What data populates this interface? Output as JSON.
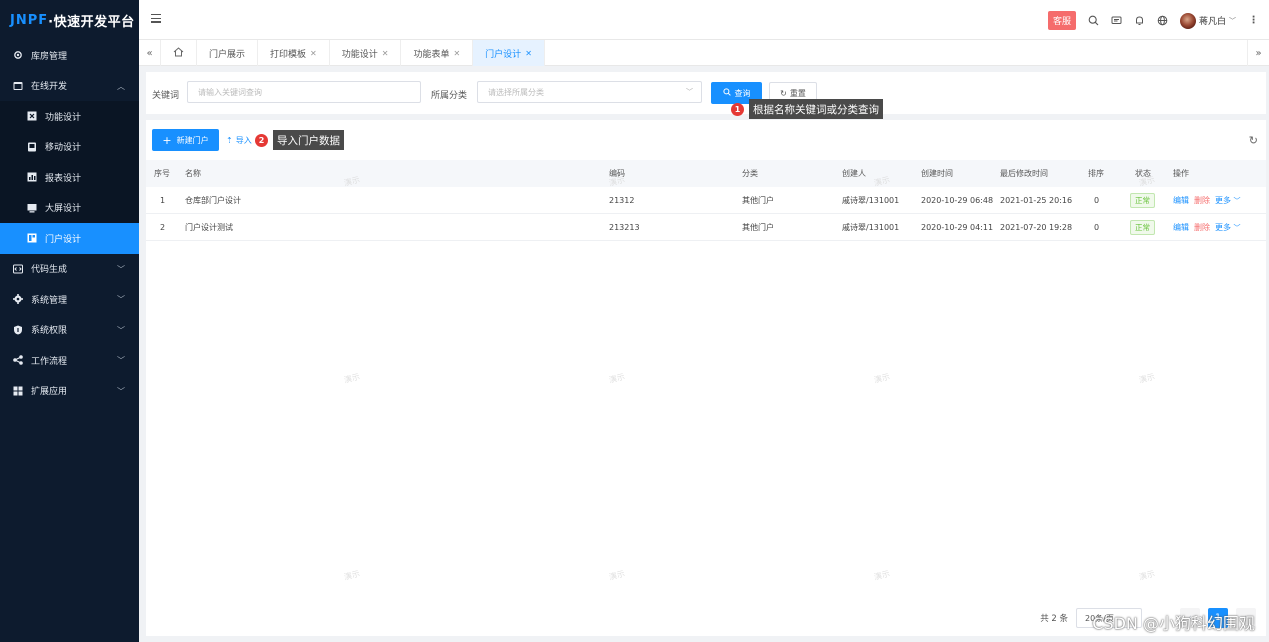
{
  "app": {
    "logo_brand": "JNPF",
    "logo_text": "·快速开发平台"
  },
  "sidebar": {
    "items": [
      {
        "label": "库房管理",
        "icon": "warehouse-icon",
        "expandable": false
      },
      {
        "label": "在线开发",
        "icon": "code-window-icon",
        "expandable": true,
        "expanded": true,
        "children": [
          {
            "label": "功能设计",
            "icon": "function-icon"
          },
          {
            "label": "移动设计",
            "icon": "mobile-icon"
          },
          {
            "label": "报表设计",
            "icon": "report-icon"
          },
          {
            "label": "大屏设计",
            "icon": "screen-icon"
          },
          {
            "label": "门户设计",
            "icon": "portal-icon",
            "active": true
          }
        ]
      },
      {
        "label": "代码生成",
        "icon": "code-icon",
        "expandable": true
      },
      {
        "label": "系统管理",
        "icon": "gear-icon",
        "expandable": true
      },
      {
        "label": "系统权限",
        "icon": "shield-icon",
        "expandable": true
      },
      {
        "label": "工作流程",
        "icon": "flow-icon",
        "expandable": true
      },
      {
        "label": "扩展应用",
        "icon": "grid-icon",
        "expandable": true
      }
    ]
  },
  "header": {
    "service_label": "客服",
    "username": "蒋凡白"
  },
  "tabs": [
    {
      "label": "门户展示",
      "closable": false
    },
    {
      "label": "打印模板",
      "closable": true
    },
    {
      "label": "功能设计",
      "closable": true
    },
    {
      "label": "功能表单",
      "closable": true
    },
    {
      "label": "门户设计",
      "closable": true,
      "active": true
    }
  ],
  "search": {
    "keyword_label": "关键词",
    "keyword_placeholder": "请输入关键词查询",
    "category_label": "所属分类",
    "category_placeholder": "请选择所属分类",
    "query_label": "查询",
    "reset_label": "重置"
  },
  "annotations": [
    {
      "num": "1",
      "text": "根据名称关键词或分类查询"
    },
    {
      "num": "2",
      "text": "导入门户数据"
    }
  ],
  "toolbar": {
    "new_label": "新建门户",
    "import_label": "导入"
  },
  "table": {
    "columns": [
      "序号",
      "名称",
      "编码",
      "分类",
      "创建人",
      "创建时间",
      "最后修改时间",
      "排序",
      "状态",
      "操作"
    ],
    "rows": [
      {
        "no": "1",
        "name": "仓库部门户设计",
        "code": "21312",
        "category": "其他门户",
        "creator": "戚诗翠/131001",
        "created": "2020-10-29 06:48",
        "modified": "2021-01-25 20:16",
        "sort": "0",
        "status": "正常"
      },
      {
        "no": "2",
        "name": "门户设计测试",
        "code": "213213",
        "category": "其他门户",
        "creator": "戚诗翠/131001",
        "created": "2020-10-29 04:11",
        "modified": "2021-07-20 19:28",
        "sort": "0",
        "status": "正常"
      }
    ],
    "actions": {
      "edit": "编辑",
      "delete": "删除",
      "more": "更多"
    },
    "watermark": "演示"
  },
  "pager": {
    "total": "共 2 条",
    "page_size": "20条/页",
    "current_page": "1"
  },
  "footer_watermark": "CSDN @小狗科幻围观",
  "colors": {
    "primary": "#1890ff",
    "sidebar_bg": "#0d1b2e",
    "danger": "#f56c6c",
    "success": "#67c23a"
  }
}
